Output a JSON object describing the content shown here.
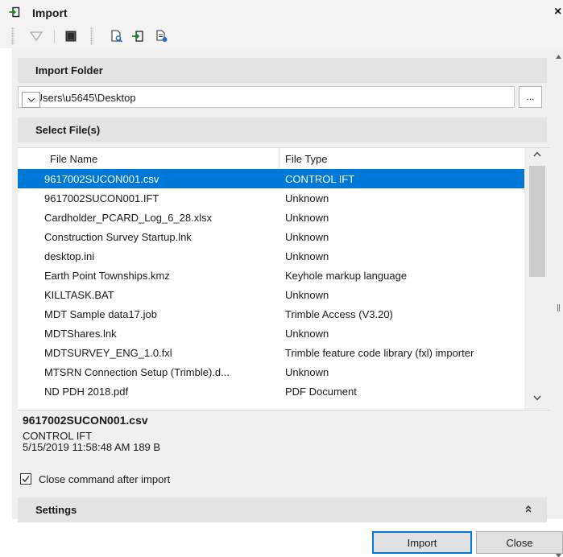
{
  "window": {
    "title": "Import",
    "close_glyph": "×"
  },
  "toolbar": {
    "icons": [
      "filter-icon",
      "panel-icon",
      "preview-search-icon",
      "import-icon",
      "file-settings-icon"
    ]
  },
  "import_folder": {
    "header": "Import Folder",
    "path": "C:\\Users\\u5645\\Desktop",
    "browse_label": "..."
  },
  "select_files": {
    "header": "Select File(s)",
    "columns": [
      "File Name",
      "File Type"
    ],
    "rows": [
      {
        "name": "9617002SUCON001.csv",
        "type": "CONTROL IFT",
        "selected": true
      },
      {
        "name": "9617002SUCON001.IFT",
        "type": "Unknown"
      },
      {
        "name": "Cardholder_PCARD_Log_6_28.xlsx",
        "type": "Unknown"
      },
      {
        "name": "Construction Survey Startup.lnk",
        "type": "Unknown"
      },
      {
        "name": "desktop.ini",
        "type": "Unknown"
      },
      {
        "name": "Earth Point Townships.kmz",
        "type": "Keyhole markup language"
      },
      {
        "name": "KILLTASK.BAT",
        "type": "Unknown"
      },
      {
        "name": "MDT Sample data17.job",
        "type": "Trimble  Access  (V3.20)"
      },
      {
        "name": "MDTShares.lnk",
        "type": "Unknown"
      },
      {
        "name": "MDTSURVEY_ENG_1.0.fxl",
        "type": "Trimble feature code library (fxl) importer"
      },
      {
        "name": "MTSRN Connection Setup (Trimble).d...",
        "type": "Unknown"
      },
      {
        "name": "ND PDH 2018.pdf",
        "type": "PDF Document"
      }
    ]
  },
  "details": {
    "name": "9617002SUCON001.csv",
    "type": "CONTROL IFT",
    "date_size": "5/15/2019 11:58:48 AM  189 B"
  },
  "close_after_import": {
    "label": "Close command after import",
    "checked": true
  },
  "settings": {
    "header": "Settings"
  },
  "buttons": {
    "import": "Import",
    "close": "Close"
  },
  "colors": {
    "selection": "#0078d7",
    "section_header": "#e3e3e3",
    "panel": "#f0f0f0"
  }
}
